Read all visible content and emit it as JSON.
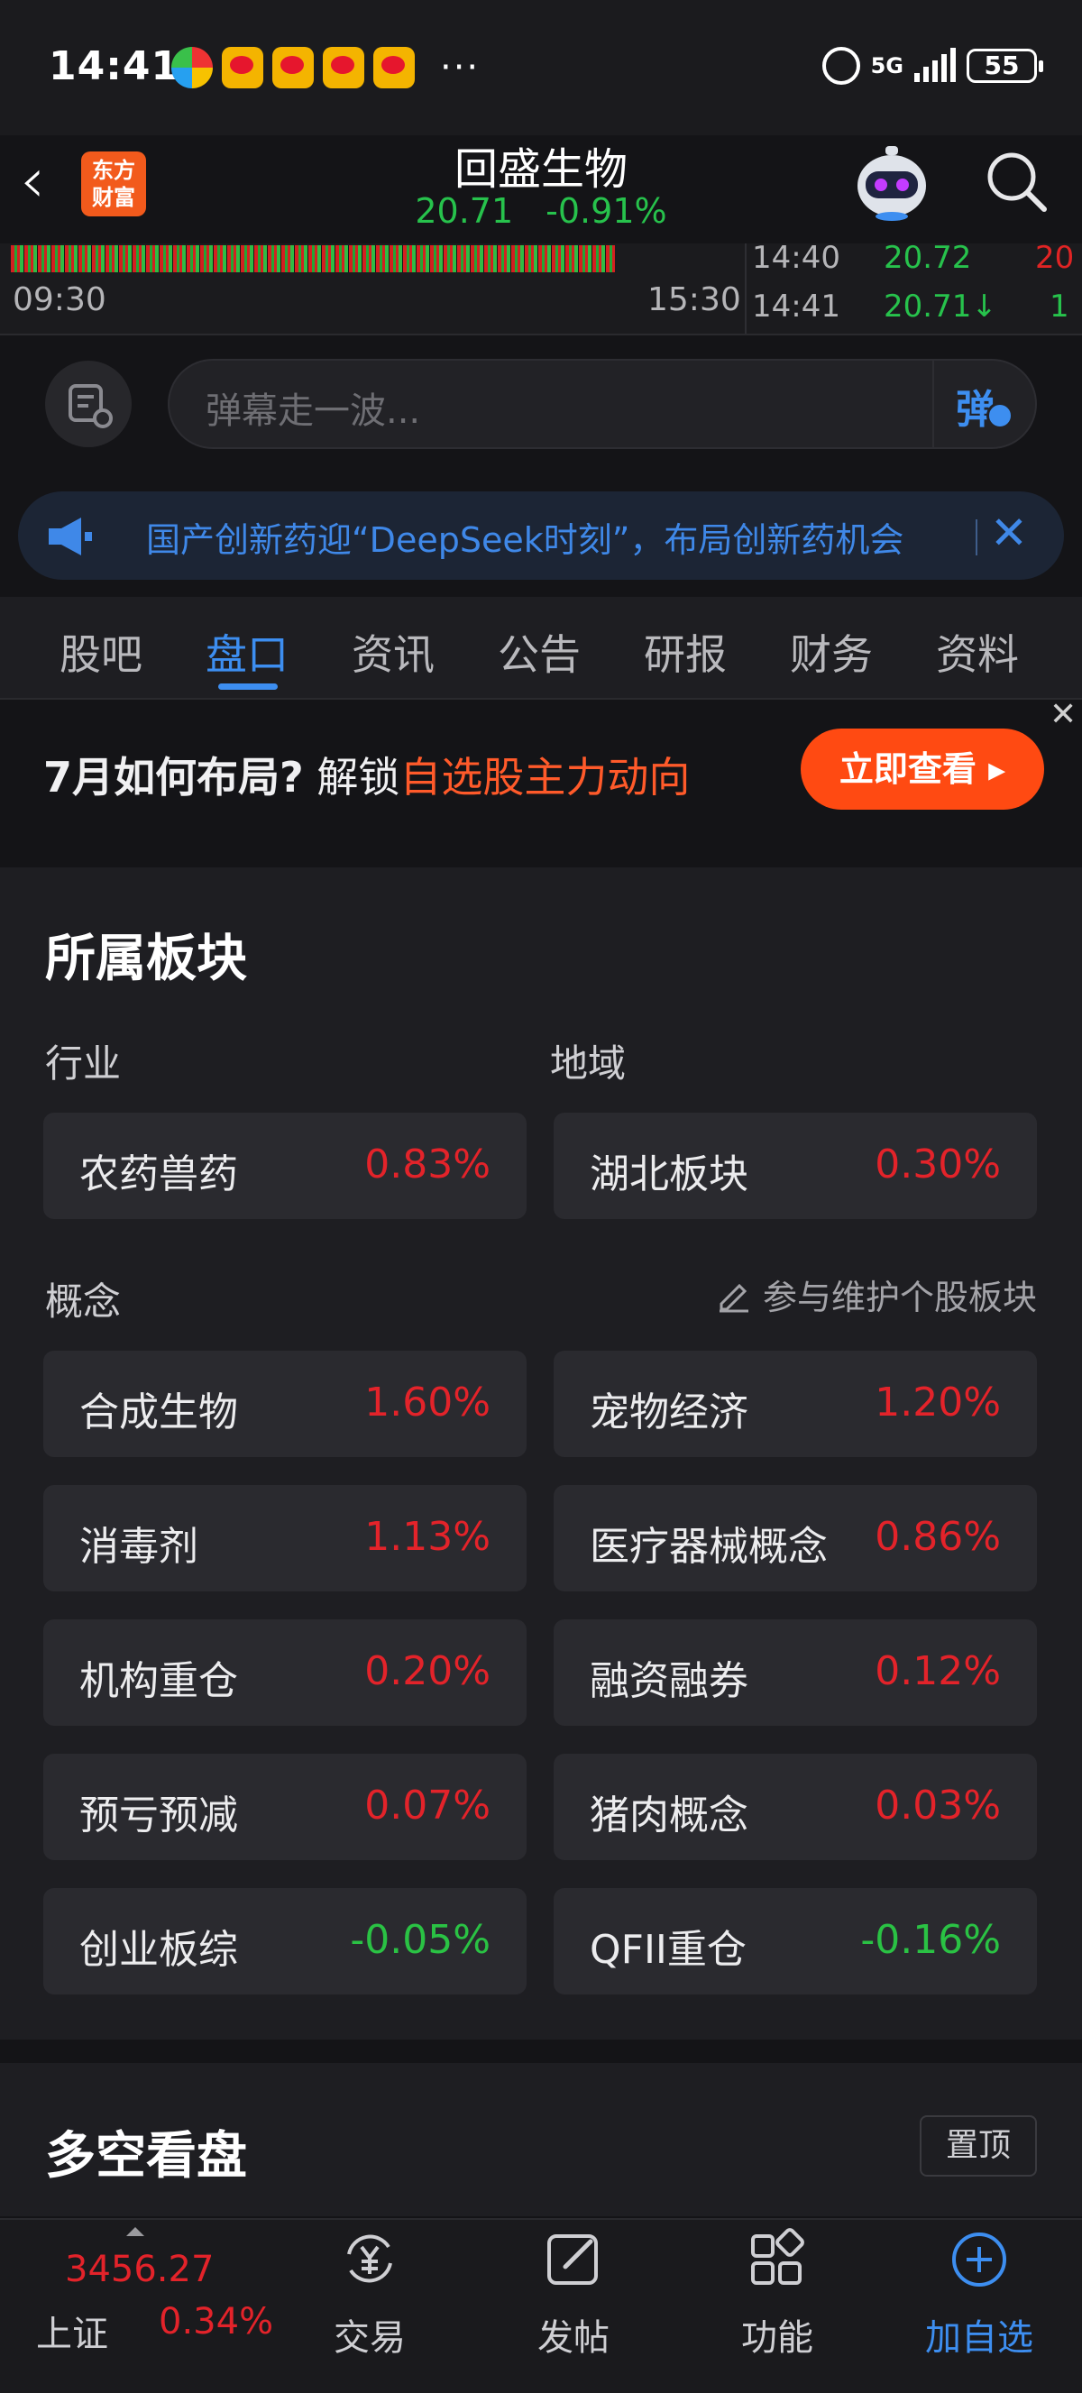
{
  "status_bar": {
    "time": "14:41",
    "network": "5G",
    "battery": "55",
    "more": "···"
  },
  "stock": {
    "name": "回盛生物",
    "price": "20.71",
    "change_pct": "-0.91%",
    "logo_line1": "东方",
    "logo_line2": "财富",
    "color_down": "#27c24c",
    "color_up": "#e3232a"
  },
  "chart_strip": {
    "time_start": "09:30",
    "time_end": "15:30",
    "ticks": [
      {
        "time": "14:40",
        "price": "20.72",
        "volume": "20"
      },
      {
        "time": "14:41",
        "price": "20.71↓",
        "volume": "1"
      }
    ]
  },
  "danmaku": {
    "placeholder": "弹幕走一波...",
    "button": "弹"
  },
  "announcement": {
    "text": "国产创新药迎“DeepSeek时刻”，布局创新药机会"
  },
  "tabs": [
    {
      "label": "股吧",
      "active": false
    },
    {
      "label": "盘口",
      "active": true
    },
    {
      "label": "资讯",
      "active": false
    },
    {
      "label": "公告",
      "active": false
    },
    {
      "label": "研报",
      "active": false
    },
    {
      "label": "财务",
      "active": false
    },
    {
      "label": "资料",
      "active": false
    }
  ],
  "promo": {
    "part1": "7月如何布局?",
    "part2": "解锁",
    "highlight": "自选股主力动向",
    "button": "立即查看 ▸"
  },
  "sectors": {
    "title": "所属板块",
    "industry_label": "行业",
    "region_label": "地域",
    "concept_label": "概念",
    "maintain_label": "参与维护个股板块",
    "industry": {
      "name": "农药兽药",
      "value": "0.83%"
    },
    "region": {
      "name": "湖北板块",
      "value": "0.30%"
    },
    "concepts": [
      {
        "name": "合成生物",
        "value": "1.60%",
        "trend": "up"
      },
      {
        "name": "宠物经济",
        "value": "1.20%",
        "trend": "up"
      },
      {
        "name": "消毒剂",
        "value": "1.13%",
        "trend": "up"
      },
      {
        "name": "医疗器械概念",
        "value": "0.86%",
        "trend": "up"
      },
      {
        "name": "机构重仓",
        "value": "0.20%",
        "trend": "up"
      },
      {
        "name": "融资融券",
        "value": "0.12%",
        "trend": "up"
      },
      {
        "name": "预亏预减",
        "value": "0.07%",
        "trend": "up"
      },
      {
        "name": "猪肉概念",
        "value": "0.03%",
        "trend": "up"
      },
      {
        "name": "创业板综",
        "value": "-0.05%",
        "trend": "down"
      },
      {
        "name": "QFII重仓",
        "value": "-0.16%",
        "trend": "down"
      }
    ]
  },
  "long_short": {
    "title": "多空看盘",
    "pin_button": "置顶"
  },
  "bottom_bar": {
    "index_value": "3456.27",
    "index_name": "上证",
    "index_pct": "0.34%",
    "items": [
      {
        "label": "交易",
        "icon": "yen-cycle-icon"
      },
      {
        "label": "发帖",
        "icon": "edit-icon"
      },
      {
        "label": "功能",
        "icon": "grid-icon"
      },
      {
        "label": "加自选",
        "icon": "add-circle-icon"
      }
    ]
  }
}
